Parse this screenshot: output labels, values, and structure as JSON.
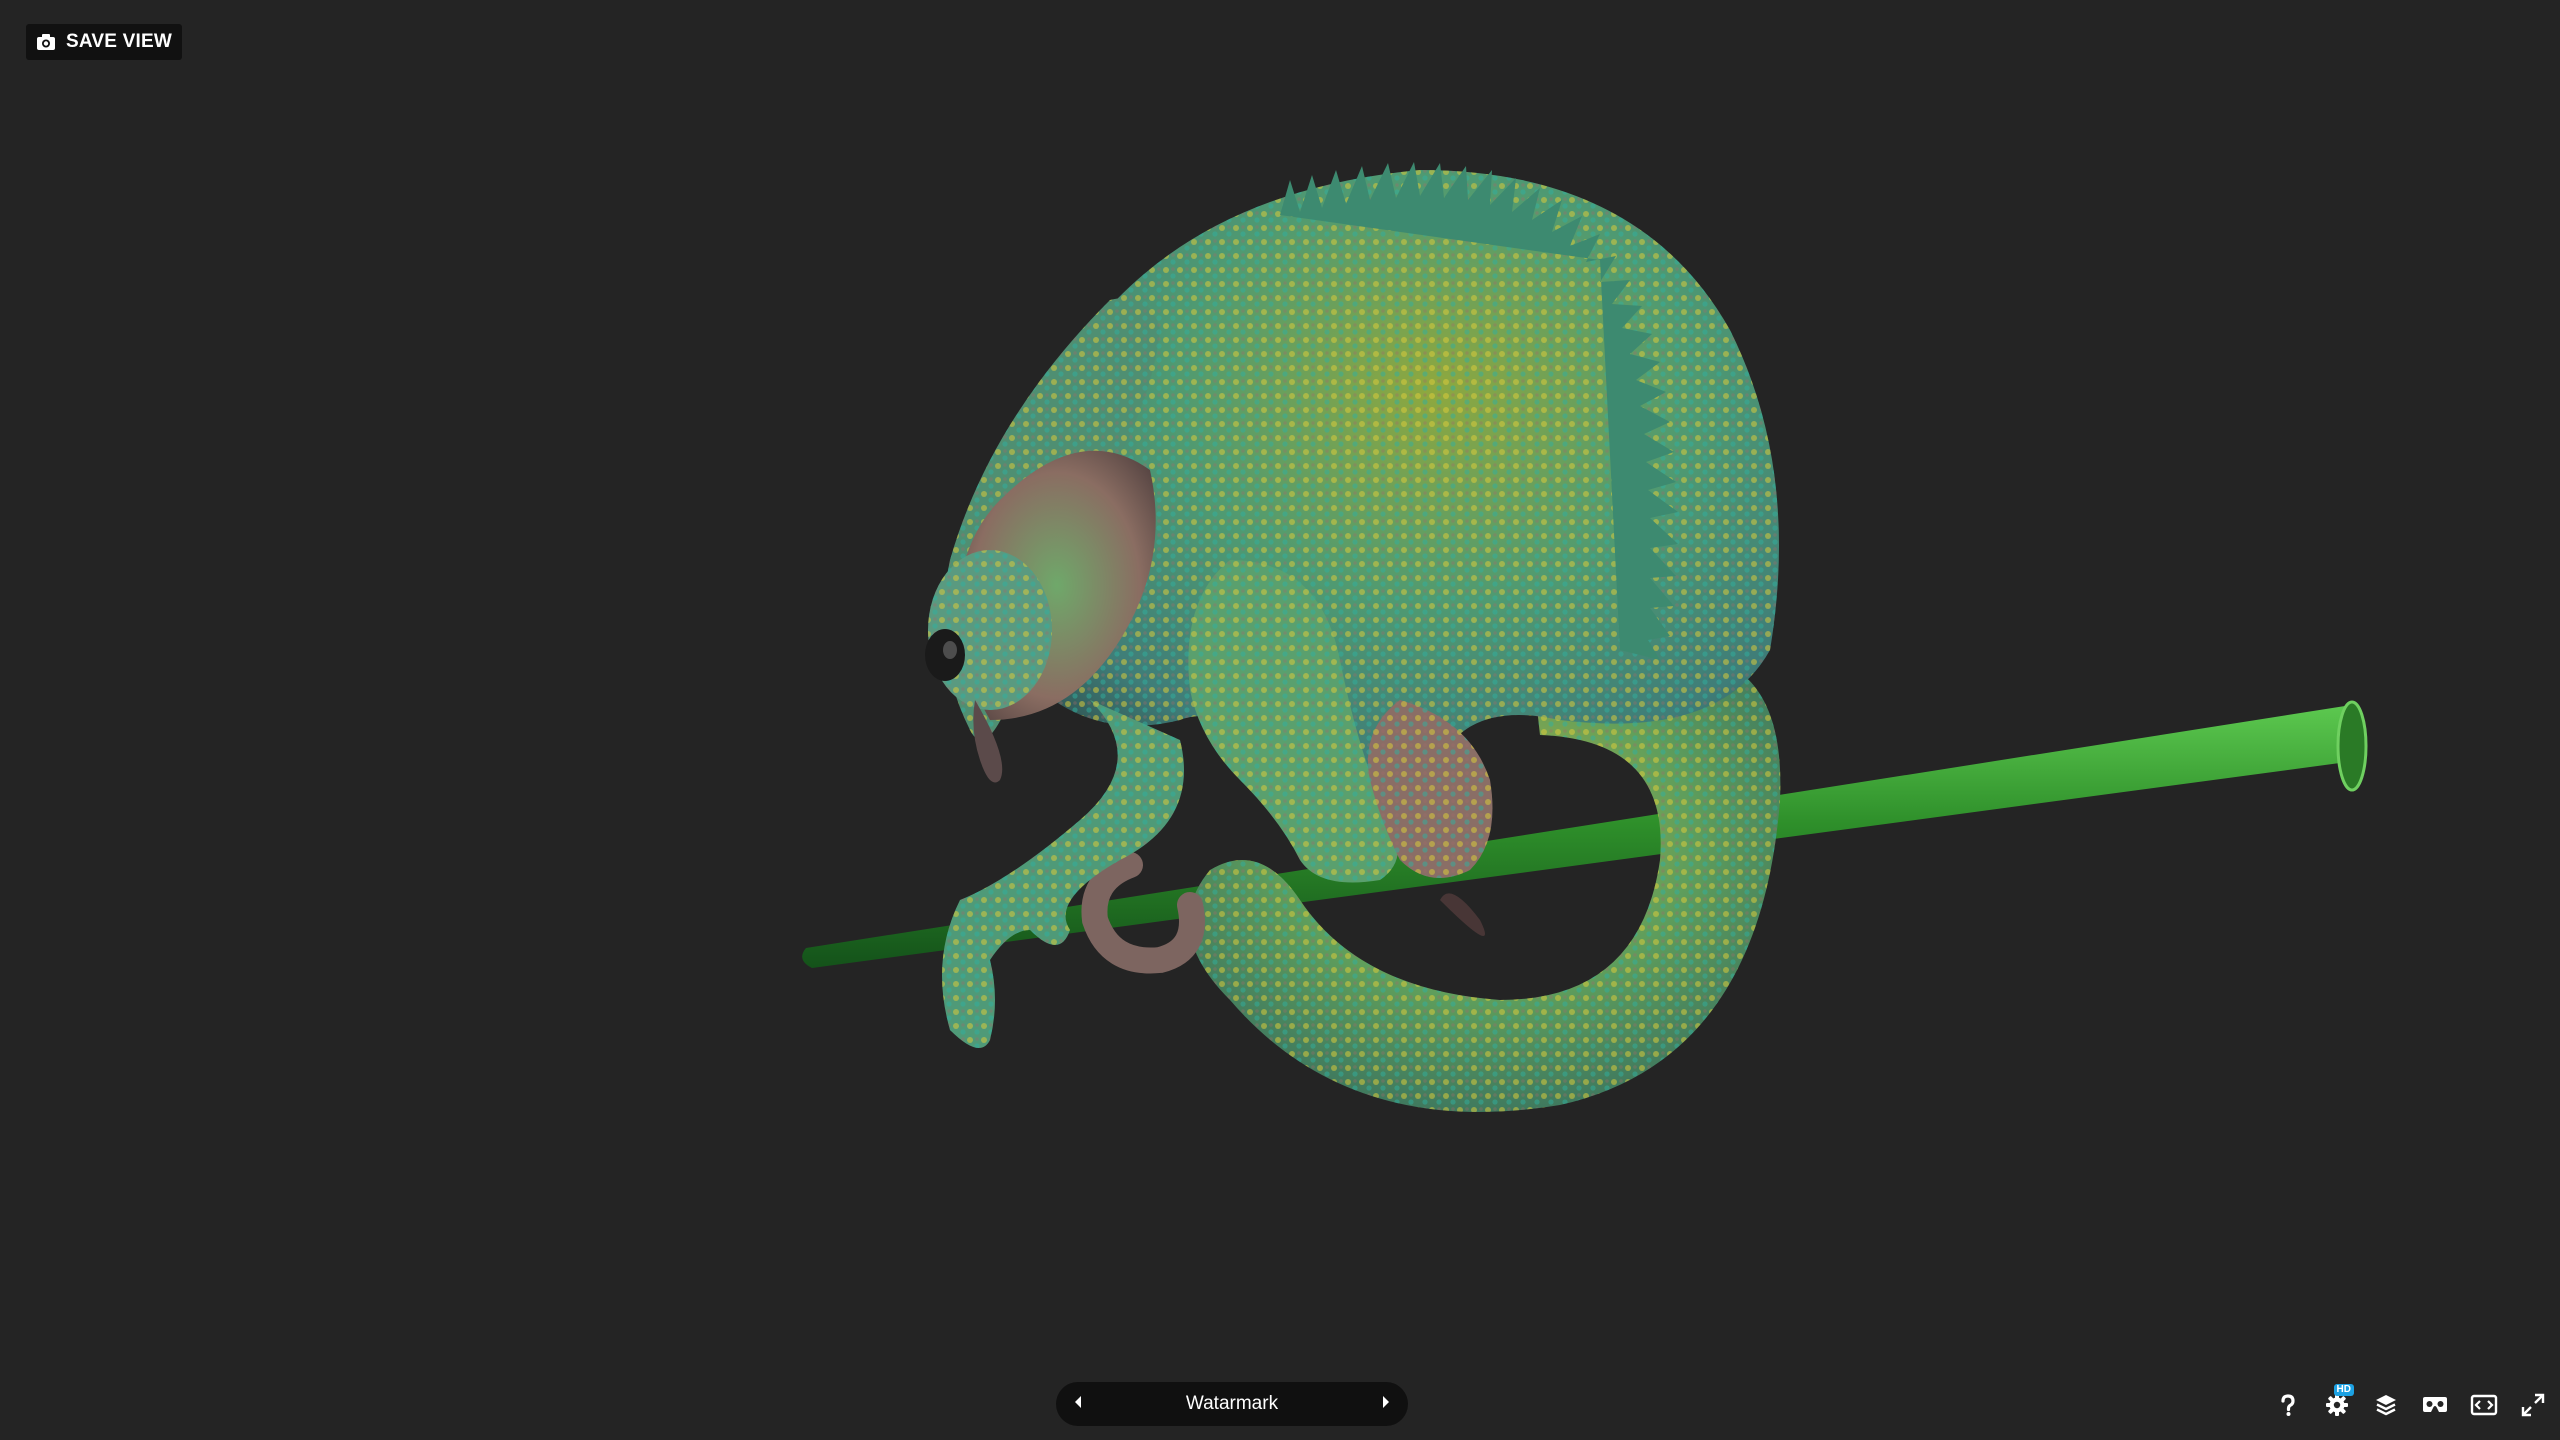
{
  "header": {
    "save_view_label": "SAVE VIEW"
  },
  "annotation": {
    "title": "Watarmark",
    "prev_icon": "chevron-left-icon",
    "next_icon": "chevron-right-icon"
  },
  "toolbar": {
    "hd_badge": "HD",
    "tools": [
      {
        "name": "help",
        "icon": "question-icon"
      },
      {
        "name": "settings",
        "icon": "gear-icon"
      },
      {
        "name": "layers",
        "icon": "layers-icon"
      },
      {
        "name": "vr",
        "icon": "vr-headset-icon"
      },
      {
        "name": "embed",
        "icon": "embed-code-icon"
      },
      {
        "name": "fullscreen",
        "icon": "fullscreen-icon"
      }
    ]
  },
  "colors": {
    "background": "#242424",
    "panel": "#101010",
    "accent": "#1ca1e3",
    "branch": "#2e8f2a",
    "chameleon_green": "#4aa86a",
    "chameleon_yellow": "#c9b838",
    "chameleon_pink": "#9a6a6a"
  }
}
